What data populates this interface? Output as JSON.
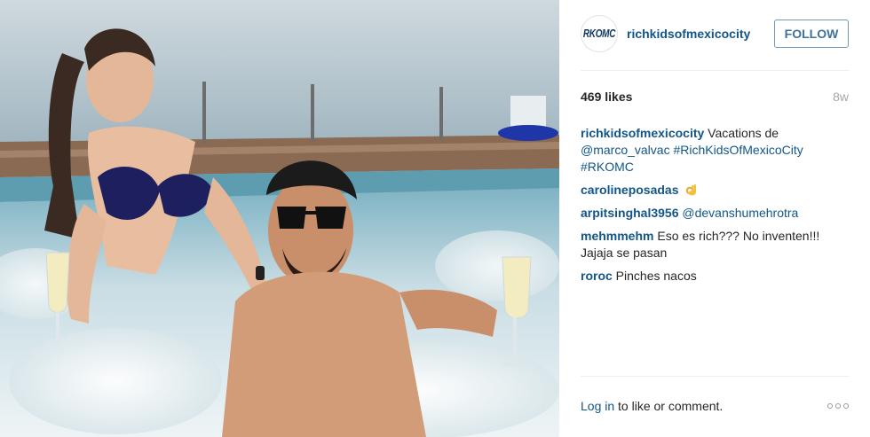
{
  "post": {
    "image_alt": "Two people holding champagne flutes in a rooftop hot tub overlooking the sea"
  },
  "header": {
    "avatar_text": "RKOMC",
    "username": "richkidsofmexicocity",
    "follow_label": "FOLLOW"
  },
  "stats": {
    "likes": "469 likes",
    "time_ago": "8w"
  },
  "caption": {
    "user": "richkidsofmexicocity",
    "text": " Vacations de ",
    "mention": "@marco_valvac",
    "hashtag1": " #RichKidsOfMexicoCity",
    "hashtag2": "#RKOMC"
  },
  "comments": [
    {
      "user": "carolineposadas",
      "text": "",
      "emoji": "ok-hand-icon"
    },
    {
      "user": "arpitsinghal3956",
      "text": "@devanshumehrotra"
    },
    {
      "user": "mehmmehm",
      "text": " Eso es rich??? No inventen!!! Jajaja se pasan"
    },
    {
      "user": "roroc",
      "text": " Pinches nacos"
    }
  ],
  "footer": {
    "login_link": "Log in",
    "login_text": " to like or comment."
  },
  "colors": {
    "link": "#125688",
    "follow_border": "#6f97b6",
    "muted": "#a5a7aa"
  }
}
